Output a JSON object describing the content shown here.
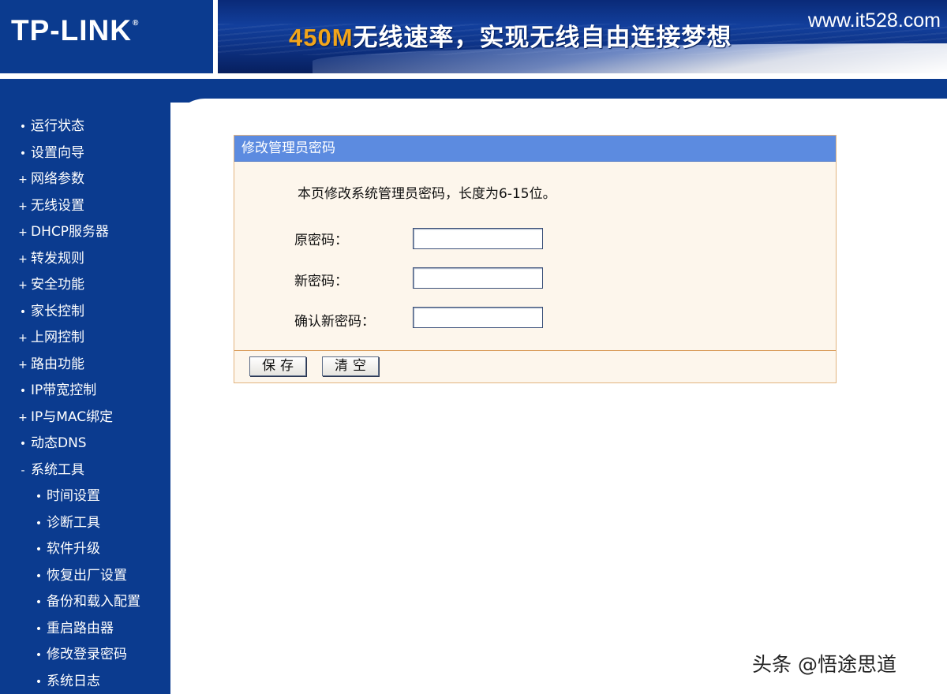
{
  "header": {
    "logo": "TP-LINK",
    "logo_mark": "®",
    "slogan_number": "450M",
    "slogan_text": "无线速率，实现无线自由连接梦想",
    "watermark_site": "www.it528.com"
  },
  "sidebar": {
    "items": [
      {
        "label": "运行状态",
        "bullet": "•"
      },
      {
        "label": "设置向导",
        "bullet": "•"
      },
      {
        "label": "网络参数",
        "bullet": "+"
      },
      {
        "label": "无线设置",
        "bullet": "+"
      },
      {
        "label": "DHCP服务器",
        "bullet": "+"
      },
      {
        "label": "转发规则",
        "bullet": "+"
      },
      {
        "label": "安全功能",
        "bullet": "+"
      },
      {
        "label": "家长控制",
        "bullet": "•"
      },
      {
        "label": "上网控制",
        "bullet": "+"
      },
      {
        "label": "路由功能",
        "bullet": "+"
      },
      {
        "label": "IP带宽控制",
        "bullet": "•"
      },
      {
        "label": "IP与MAC绑定",
        "bullet": "+"
      },
      {
        "label": "动态DNS",
        "bullet": "•"
      },
      {
        "label": "系统工具",
        "bullet": "-"
      }
    ],
    "sub_items": [
      {
        "label": "时间设置",
        "bullet": "•"
      },
      {
        "label": "诊断工具",
        "bullet": "•"
      },
      {
        "label": "软件升级",
        "bullet": "•"
      },
      {
        "label": "恢复出厂设置",
        "bullet": "•"
      },
      {
        "label": "备份和载入配置",
        "bullet": "•"
      },
      {
        "label": "重启路由器",
        "bullet": "•"
      },
      {
        "label": "修改登录密码",
        "bullet": "•"
      },
      {
        "label": "系统日志",
        "bullet": "•"
      }
    ]
  },
  "form": {
    "title": "修改管理员密码",
    "description": "本页修改系统管理员密码，长度为6-15位。",
    "old_password_label": "原密码：",
    "old_password_value": "",
    "new_password_label": "新密码：",
    "new_password_value": "",
    "confirm_password_label": "确认新密码：",
    "confirm_password_value": "",
    "save_label": "保存",
    "clear_label": "清空"
  },
  "watermark": {
    "credit": "头条 @悟途思道"
  }
}
